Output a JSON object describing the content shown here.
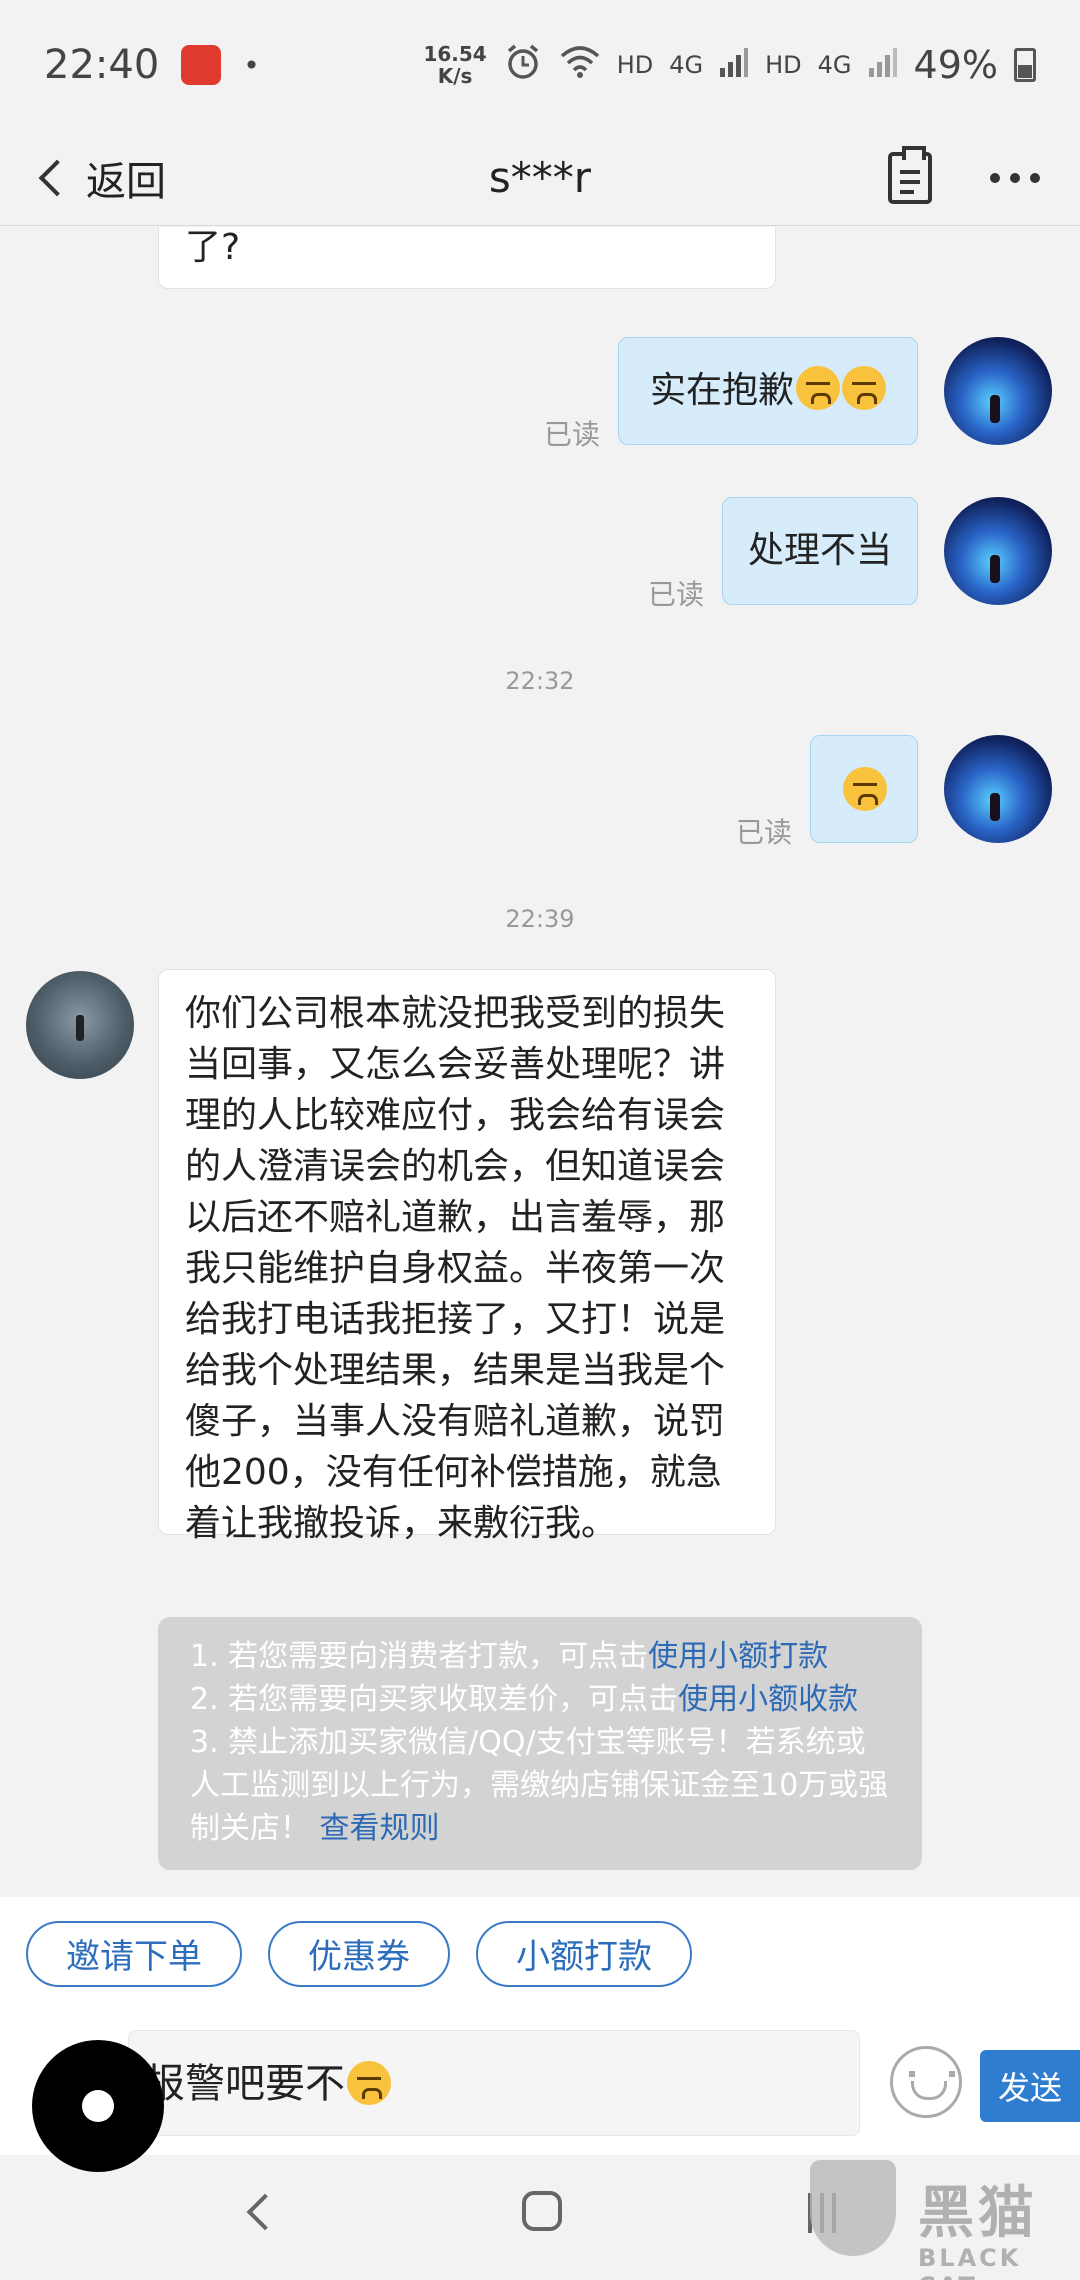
{
  "status_bar": {
    "time": "22:40",
    "dot": "•",
    "net_speed_value": "16.54",
    "net_speed_unit": "K/s",
    "hd1": "HD",
    "net1": "4G",
    "hd2": "HD",
    "net2": "4G",
    "battery": "49%"
  },
  "header": {
    "back_label": "返回",
    "title": "s***r"
  },
  "messages": {
    "partial_left": "了?",
    "msg1": {
      "text": "实在抱歉",
      "read": "已读"
    },
    "msg2": {
      "text": "处理不当",
      "read": "已读"
    },
    "time1": "22:32",
    "msg3": {
      "read": "已读"
    },
    "time2": "22:39",
    "long_left": "你们公司根本就没把我受到的损失当回事，又怎么会妥善处理呢？讲理的人比较难应付，我会给有误会的人澄清误会的机会，但知道误会以后还不赔礼道歉，出言羞辱，那我只能维护自身权益。半夜第一次给我打电话我拒接了，又打！说是给我个处理结果，结果是当我是个傻子，当事人没有赔礼道歉，说罚他200，没有任何补偿措施，就急着让我撤投诉，来敷衍我。"
  },
  "notice": {
    "line1_text": "1. 若您需要向消费者打款，可点击",
    "line1_link": "使用小额打款",
    "line2_text": "2. 若您需要向买家收取差价，可点击",
    "line2_link": "使用小额收款",
    "line3_text": "3. 禁止添加买家微信/QQ/支付宝等账号！若系统或人工监测到以上行为，需缴纳店铺保证金至10万或强制关店！",
    "line3_link": "查看规则"
  },
  "quick_actions": [
    "邀请下单",
    "优惠券",
    "小额打款"
  ],
  "input": {
    "value": "报警吧要不",
    "send_label": "发送"
  },
  "watermark": {
    "text": "黑猫",
    "sub": "BLACK CAT"
  },
  "icons": {
    "accent": "#2f7dd1",
    "bubble_right": "#d6ecfb",
    "notice_bg": "#d3d3d3"
  }
}
